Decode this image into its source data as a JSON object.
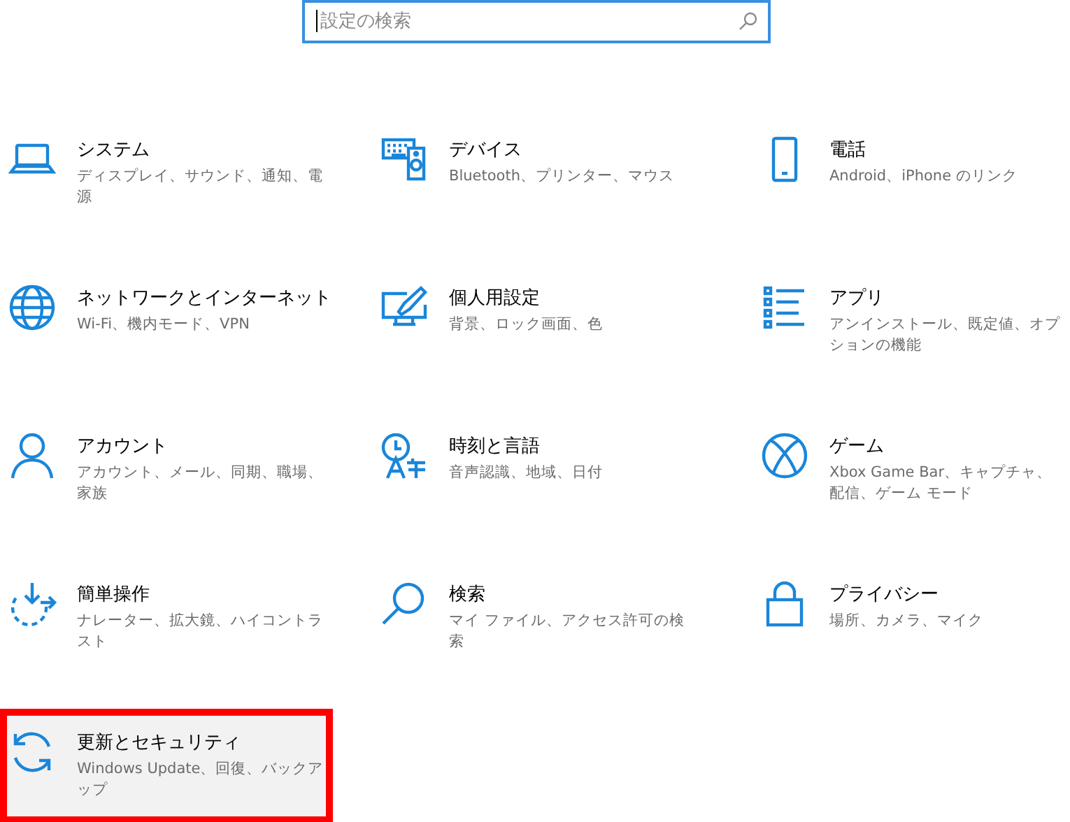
{
  "search": {
    "placeholder": "設定の検索"
  },
  "categories": [
    {
      "title": "システム",
      "description": "ディスプレイ、サウンド、通知、電源",
      "highlighted": false
    },
    {
      "title": "デバイス",
      "description": "Bluetooth、プリンター、マウス",
      "highlighted": false
    },
    {
      "title": "電話",
      "description": "Android、iPhone のリンク",
      "highlighted": false
    },
    {
      "title": "ネットワークとインターネット",
      "description": "Wi-Fi、機内モード、VPN",
      "highlighted": false
    },
    {
      "title": "個人用設定",
      "description": "背景、ロック画面、色",
      "highlighted": false
    },
    {
      "title": "アプリ",
      "description": "アンインストール、既定値、オプションの機能",
      "highlighted": false
    },
    {
      "title": "アカウント",
      "description": "アカウント、メール、同期、職場、家族",
      "highlighted": false
    },
    {
      "title": "時刻と言語",
      "description": "音声認識、地域、日付",
      "highlighted": false
    },
    {
      "title": "ゲーム",
      "description": "Xbox Game Bar、キャプチャ、配信、ゲーム モード",
      "highlighted": false
    },
    {
      "title": "簡単操作",
      "description": "ナレーター、拡大鏡、ハイコントラスト",
      "highlighted": false
    },
    {
      "title": "検索",
      "description": "マイ ファイル、アクセス許可の検索",
      "highlighted": false
    },
    {
      "title": "プライバシー",
      "description": "場所、カメラ、マイク",
      "highlighted": false
    },
    {
      "title": "更新とセキュリティ",
      "description": "Windows Update、回復、バックアップ",
      "highlighted": true
    }
  ]
}
